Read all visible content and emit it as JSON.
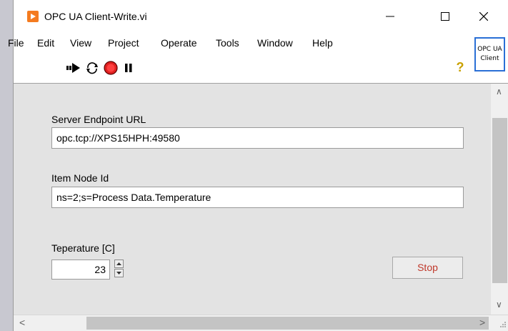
{
  "window": {
    "title": "OPC UA Client-Write.vi",
    "controls": {
      "minimize_icon": "minimize-icon",
      "maximize_icon": "maximize-icon",
      "close_icon": "close-icon"
    }
  },
  "menu": [
    "File",
    "Edit",
    "View",
    "Project",
    "Operate",
    "Tools",
    "Window",
    "Help"
  ],
  "toolbar": {
    "icons": [
      "run-arrow-icon",
      "run-continuously-icon",
      "abort-icon",
      "pause-icon"
    ],
    "help_icon": "help-icon",
    "vi_icon_lines": [
      "OPC UA",
      "Client"
    ]
  },
  "front_panel": {
    "server_url_label": "Server Endpoint URL",
    "server_url_value": "opc.tcp://XPS15HPH:49580",
    "node_id_label": "Item Node Id",
    "node_id_value": "ns=2;s=Process Data.Temperature",
    "temperature_label": "Teperature [C]",
    "temperature_value": "23",
    "stop_label": "Stop"
  },
  "colors": {
    "logo": "#f47b20",
    "stop_text": "#c0392b",
    "abort_red": "#e02020",
    "vi_icon_border": "#2a6fd6"
  }
}
